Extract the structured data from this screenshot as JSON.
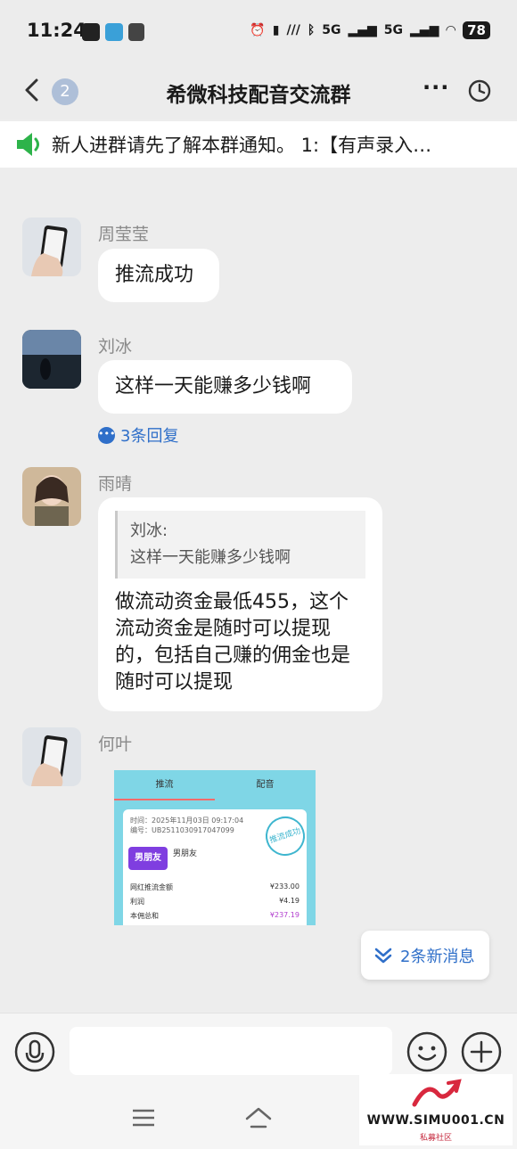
{
  "status_bar": {
    "time": "11:24",
    "signal_1": "5G",
    "signal_2": "5G",
    "battery": "78"
  },
  "header": {
    "unread_badge": "2",
    "title": "希微科技配音交流群",
    "more": "···"
  },
  "notice": {
    "text": "新人进群请先了解本群通知。 1:【有声录入…"
  },
  "messages": [
    {
      "sender": "周莹莹",
      "text": "推流成功"
    },
    {
      "sender": "刘冰",
      "text": "这样一天能赚多少钱啊",
      "replies": "3条回复"
    },
    {
      "sender": "雨晴",
      "quote_sender": "刘冰:",
      "quote_text": "这样一天能赚多少钱啊",
      "text": "做流动资金最低455，这个流动资金是随时可以提现的，包括自己赚的佣金也是随时可以提现"
    },
    {
      "sender": "何叶"
    }
  ],
  "image_message": {
    "tab_active": "推流",
    "tab_other": "配音",
    "time_line": "时间：2025年11月03日 09:17:04",
    "id_line": "编号：UB2511030917047099",
    "stamp": "推流成功",
    "badge": "男朋友",
    "product": "男朋友",
    "rows": [
      {
        "label": "网红推流金额",
        "value": "¥233.00"
      },
      {
        "label": "利润",
        "value": "¥4.19"
      },
      {
        "label": "本佣总和",
        "value": "¥237.19"
      }
    ]
  },
  "new_messages": "2条新消息",
  "watermark": {
    "site": "WWW.SIMU001.CN",
    "sub": "私募社区"
  },
  "colors": {
    "accent": "#2f6fc9",
    "background": "#ededed",
    "speaker": "#2db34a"
  }
}
